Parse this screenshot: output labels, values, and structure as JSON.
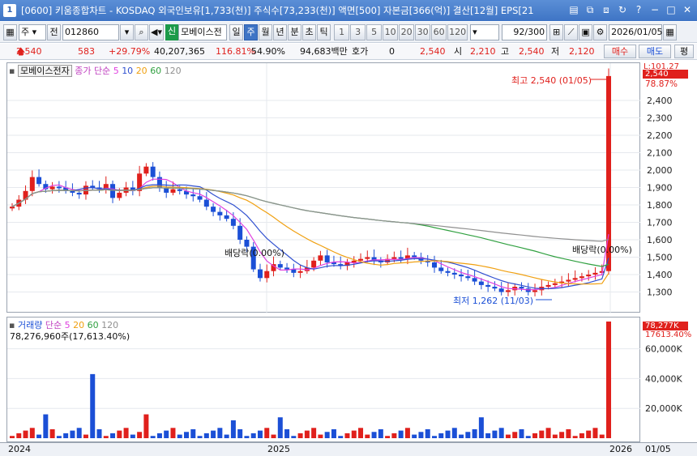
{
  "window": {
    "number": "1",
    "title": "[0600] 키움종합차트 - KOSDAQ 외국인보유[1,733(천)] 주식수[73,233(천)] 액면[500] 자본금[366(억)] 결산[12월] EPS[21",
    "buttons": [
      "▤",
      "⧉",
      "⧈",
      "↻",
      "?",
      "−",
      "□",
      "✕"
    ]
  },
  "toolbar": {
    "market": "주",
    "scope": "전",
    "code": "012860",
    "name": "모베이스전",
    "name_tag": "신",
    "periods": [
      "일",
      "주",
      "월",
      "년",
      "분",
      "초",
      "틱"
    ],
    "active_period": "주",
    "intervals": [
      "1",
      "3",
      "5",
      "10",
      "20",
      "30",
      "60",
      "120"
    ],
    "count": "92",
    "count_total": "/300",
    "date": "2026/01/05"
  },
  "quote": {
    "price": "2,540",
    "change": "583",
    "change_pct": "+29.79%",
    "volume": "40,207,365",
    "vol_ratio": "116.81%",
    "turnover": "54.90%",
    "amount": "94,683백만",
    "hoga_label": "호가",
    "hoga_value": "0",
    "hoga_price": "2,540",
    "open_label": "시",
    "open": "2,210",
    "high_label": "고",
    "high": "2,540",
    "low_label": "저",
    "low": "2,120",
    "buy_button": "매수",
    "sell_button": "매도",
    "eval_button": "평"
  },
  "price_panel": {
    "stock_label": "모베이스전자",
    "ma_label": "종가 단순",
    "ma_periods": [
      "5",
      "10",
      "20",
      "60",
      "120"
    ],
    "ma_colors": [
      "#e040e0",
      "#3050d0",
      "#f0a010",
      "#30a040",
      "#909090"
    ],
    "high_annotation": "최고 2,540 (01/05)",
    "low_annotation": "최저 1,262 (11/03)",
    "dividend_1": "배당락(0.00%)",
    "dividend_2": "배당락(0.00%)",
    "axis_top_label": "L:101.27",
    "current_tag": "2,540",
    "current_pct": "78.87%",
    "y_ticks": [
      "2,400",
      "2,300",
      "2,200",
      "2,100",
      "2,000",
      "1,900",
      "1,800",
      "1,700",
      "1,600",
      "1,500",
      "1,400",
      "1,300"
    ]
  },
  "volume_panel": {
    "label": "거래량",
    "ma_label": "단순",
    "ma_periods": [
      "5",
      "20",
      "60",
      "120"
    ],
    "ma_colors": [
      "#e040e0",
      "#f0a010",
      "#30a040",
      "#909090"
    ],
    "current": "78,276,960주(17,613.40%)",
    "current_tag": "78,277K",
    "current_pct": "17613.40%",
    "y_ticks": [
      "60,000K",
      "40,000K",
      "20,000K"
    ]
  },
  "x_axis": {
    "labels": [
      "2024",
      "2025",
      "2026",
      "01/05"
    ]
  }
}
